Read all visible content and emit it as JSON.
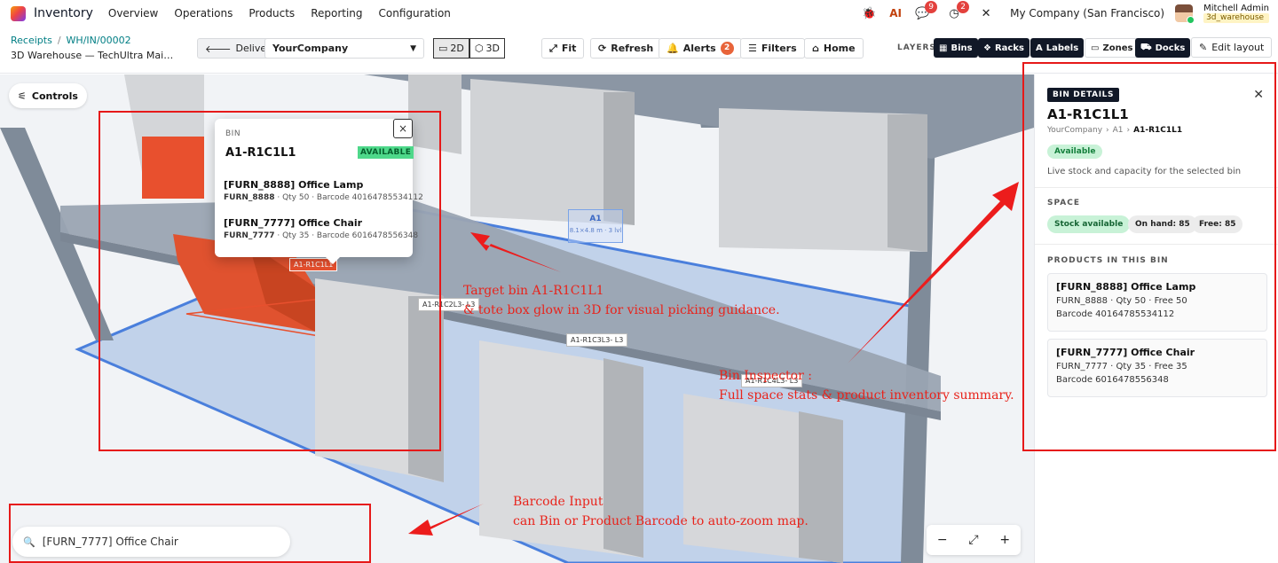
{
  "app": {
    "name": "Inventory"
  },
  "menu": [
    "Overview",
    "Operations",
    "Products",
    "Reporting",
    "Configuration"
  ],
  "topbar": {
    "messages_count": "9",
    "activity_count": "2",
    "company": "My Company (San Francisco)",
    "user_name": "Mitchell Admin",
    "database": "3d_warehouse"
  },
  "breadcrumb": {
    "parent": "Receipts",
    "record": "WH/IN/00002"
  },
  "subtitle": "3D Warehouse — TechUltra Main ...",
  "toolbar": {
    "delivery": "Delivery",
    "company_select": "YourCompany",
    "view_2d": "2D",
    "view_3d": "3D",
    "fit": "Fit",
    "refresh": "Refresh",
    "alerts": "Alerts",
    "alerts_count": "2",
    "filters": "Filters",
    "home": "Home",
    "layers_label": "LAYERS",
    "layers": {
      "bins": "Bins",
      "racks": "Racks",
      "labels": "Labels",
      "zones": "Zones",
      "docks": "Docks"
    },
    "edit_layout": "Edit layout"
  },
  "viewport": {
    "controls": "Controls",
    "zone_label": {
      "name": "A1",
      "dims": "8.1×4.8 m · 3 lvl"
    },
    "bin_tags": {
      "selected": "A1-R1C1L1",
      "tag2": "A1-R1C2L3- L3",
      "tag3": "A1-R1C3L3- L3",
      "tag4": "A1-R1C4L3- L3"
    }
  },
  "popup": {
    "type": "BIN",
    "title": "A1-R1C1L1",
    "status": "AVAILABLE",
    "items": [
      {
        "name": "[FURN_8888] Office Lamp",
        "code": "FURN_8888",
        "qty": "Qty 50",
        "barcode": "Barcode 40164785534112"
      },
      {
        "name": "[FURN_7777] Office Chair",
        "code": "FURN_7777",
        "qty": "Qty 35",
        "barcode": "Barcode 6016478556348"
      }
    ]
  },
  "search": {
    "value": "[FURN_7777] Office Chair"
  },
  "annotations": {
    "target_line1": "Target bin A1-R1C1L1",
    "target_line2": "& tote box glow in 3D for visual picking guidance.",
    "inspector_line1": "Bin Inspector :",
    "inspector_line2": "Full space stats  & product inventory summary.",
    "barcode_line1": "Barcode Input",
    "barcode_line2": "can Bin or Product Barcode to auto-zoom map."
  },
  "panel": {
    "tag": "BIN DETAILS",
    "title": "A1-R1C1L1",
    "crumbs": [
      "YourCompany",
      "A1",
      "A1-R1C1L1"
    ],
    "status": "Available",
    "description": "Live stock and capacity for the selected bin",
    "space_title": "SPACE",
    "stock": "Stock available",
    "on_hand": "On hand: 85",
    "free": "Free: 85",
    "products_title": "PRODUCTS IN THIS BIN",
    "products": [
      {
        "name": "[FURN_8888] Office Lamp",
        "line": "FURN_8888 · Qty 50 · Free 50",
        "barcode": "Barcode 40164785534112"
      },
      {
        "name": "[FURN_7777] Office Chair",
        "line": "FURN_7777 · Qty 35 · Free 35",
        "barcode": "Barcode 6016478556348"
      }
    ]
  },
  "colors": {
    "accent_teal": "#017e84",
    "bin_selected": "#e8502e",
    "annotation": "#e8241c",
    "zone_blue": "#4a7fdc"
  }
}
